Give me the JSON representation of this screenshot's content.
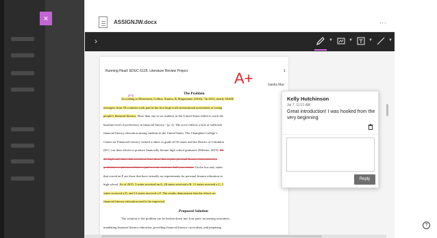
{
  "viewer": {
    "close_label": "×",
    "file_name": "ASSIGNJW.docx",
    "more_label": "...",
    "nav_arrow": "›"
  },
  "toolbar": {
    "tools": [
      "pen-icon",
      "stamp-icon",
      "text-icon",
      "line-icon"
    ],
    "active_tool_color": "#d466e0"
  },
  "document": {
    "running_head": "Running Head: EDUC 6125: Literature Review Project",
    "page_number": "1",
    "author": "Sandra May",
    "grade_annotation": "A+",
    "grade_color": "#e0262b",
    "problem_heading": "The Problem",
    "problem_lines": [
      {
        "segments": [
          {
            "text": "According to Mortensen, Collins, Simms, & Mugazinner (2016), \"In 2012, nearly 30,000",
            "style": "hl"
          }
        ]
      },
      {
        "segments": [
          {
            "text": "teenagers from 18 countries took part in the first large-scale international assessment of young",
            "style": "hl"
          }
        ]
      },
      {
        "segments": [
          {
            "text": "people’s financial literacy.",
            "style": "hl"
          },
          {
            "text": " More than one in six students in the United States failed to reach the",
            "style": ""
          }
        ]
      },
      {
        "segments": [
          {
            "text": "baseline level of proficiency in financial literacy.\" (p. 2). The score reflects a lack of sufficient",
            "style": ""
          }
        ]
      },
      {
        "segments": [
          {
            "text": "financial literacy education among students in the United States. The Champlain College’s",
            "style": ""
          }
        ]
      },
      {
        "segments": [
          {
            "text": "Center for Financial Literacy created a rubric to grade all 50 states and the District of Columbia",
            "style": ""
          }
        ]
      },
      {
        "segments": [
          {
            "text": "(D.C.) on their efforts to produce financially literate high school graduates (Pelletier, 2015). ",
            "style": ""
          },
          {
            "text": "On",
            "style": "strike"
          }
        ]
      },
      {
        "segments": [
          {
            "text": "the high end, states that scored an A are those that require personal finance instruction as a",
            "style": "strike"
          }
        ]
      },
      {
        "segments": [
          {
            "text": "graduation requirement that is equal to a one-semester, half year course.",
            "style": "strike"
          },
          {
            "text": " On the low end, states",
            "style": ""
          }
        ]
      },
      {
        "segments": [
          {
            "text": "that scored an F are those that have virtually no requirements for personal finance education in",
            "style": ""
          }
        ]
      },
      {
        "segments": [
          {
            "text": "high school. ",
            "style": ""
          },
          {
            "text": "As of 2015, 5 states received an A, 20 states received a B, 11 states received a C, 3",
            "style": "hl"
          }
        ]
      },
      {
        "segments": [
          {
            "text": "states received a D, and 12 states received a F. The results demonstrate that the efforts on",
            "style": "hl"
          }
        ]
      },
      {
        "segments": [
          {
            "text": "financial literacy education need to be improved.",
            "style": "hl"
          }
        ]
      }
    ],
    "solution_heading": "Proposed Solution",
    "solution_lines": [
      {
        "segments": [
          {
            "text": "The solution to the problem can be broken down into four parts: increasing awareness,",
            "style": ""
          }
        ]
      },
      {
        "segments": [
          {
            "text": "mandating financial literacy education, providing financial literacy curriculum, and preparing",
            "style": ""
          }
        ]
      },
      {
        "segments": [
          {
            "text": "educators by providing adequate training to teach and facilitate a financial literacy course. ",
            "style": ""
          },
          {
            "text": "The",
            "style": "strike"
          }
        ]
      }
    ]
  },
  "comment": {
    "author": "Kelly Hutchinson",
    "timestamp": "Jul 7, 11:21 AM",
    "body": "Great introduction! I was hooked from the very beginning.",
    "input_placeholder": "",
    "reply_label": "Reply"
  },
  "help": {
    "label": "?"
  }
}
